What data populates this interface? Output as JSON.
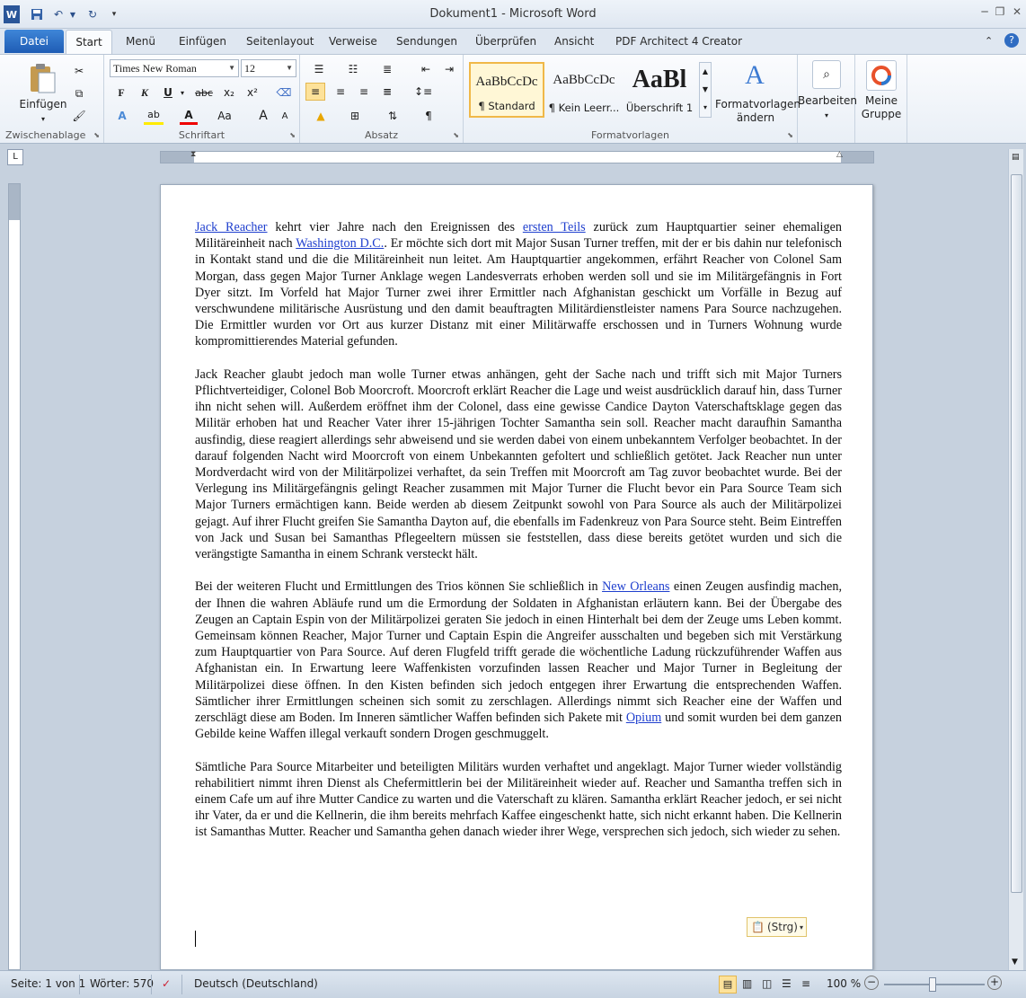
{
  "window": {
    "title": "Dokument1  -  Microsoft Word"
  },
  "tabs": [
    "Start",
    "Menü",
    "Einfügen",
    "Seitenlayout",
    "Verweise",
    "Sendungen",
    "Überprüfen",
    "Ansicht",
    "PDF Architect 4 Creator"
  ],
  "file_tab": "Datei",
  "ribbon": {
    "clipboard": {
      "paste": "Einfügen",
      "label": "Zwischenablage"
    },
    "font": {
      "name": "Times New Roman",
      "size": "12",
      "label": "Schriftart",
      "bold": "F",
      "italic": "K",
      "underline": "U",
      "strike": "abc",
      "sub": "x₂",
      "sup": "x²",
      "case": "Aa",
      "grow": "A",
      "shrink": "A"
    },
    "paragraph": {
      "label": "Absatz"
    },
    "styles": {
      "label": "Formatvorlagen",
      "items": [
        {
          "sample": "AaBbCcDc",
          "name": "¶ Standard"
        },
        {
          "sample": "AaBbCcDc",
          "name": "¶ Kein Leerr..."
        },
        {
          "sample": "AaBl",
          "name": "Überschrift 1"
        }
      ],
      "change": "Formatvorlagen ändern"
    },
    "edit": {
      "label": "Bearbeiten"
    },
    "group": {
      "label": "Meine Gruppe"
    }
  },
  "document": {
    "p1": {
      "l1": "Jack Reacher",
      "t1": " kehrt vier Jahre nach den Ereignissen des ",
      "l2": "ersten Teils",
      "t2": " zurück zum Hauptquartier seiner ehemaligen Militäreinheit nach ",
      "l3": "Washington D.C.",
      "t3": ". Er möchte sich dort mit Major Susan Turner treffen, mit der er bis dahin nur telefonisch in Kontakt stand und die die Militäreinheit nun leitet. Am Hauptquartier angekommen, erfährt Reacher von Colonel Sam Morgan, dass gegen Major Turner Anklage wegen Landesverrats erhoben werden soll und sie im Militärgefängnis in Fort Dyer sitzt. Im Vorfeld hat Major Turner zwei ihrer Ermittler nach Afghanistan geschickt um Vorfälle in Bezug auf verschwundene militärische Ausrüstung und den damit beauftragten Militärdienstleister namens Para Source nachzugehen. Die Ermittler wurden vor Ort aus kurzer Distanz mit einer Militärwaffe erschossen und in Turners Wohnung wurde kompromittierendes Material gefunden."
    },
    "p2": "Jack Reacher glaubt jedoch man wolle Turner etwas anhängen, geht der Sache nach und trifft sich mit Major Turners Pflichtverteidiger, Colonel Bob Moorcroft. Moorcroft erklärt Reacher die Lage und weist ausdrücklich darauf hin, dass Turner ihn nicht sehen will. Außerdem eröffnet ihm der Colonel, dass eine gewisse Candice Dayton Vaterschaftsklage gegen das Militär erhoben hat und Reacher Vater ihrer 15-jährigen Tochter Samantha sein soll. Reacher macht daraufhin Samantha ausfindig, diese reagiert allerdings sehr abweisend und sie werden dabei von einem unbekanntem Verfolger beobachtet. In der darauf folgenden Nacht wird Moorcroft von einem Unbekannten gefoltert und schließlich getötet. Jack Reacher nun unter Mordverdacht wird von der Militärpolizei verhaftet, da sein Treffen mit Moorcroft am Tag zuvor beobachtet wurde. Bei der Verlegung ins Militärgefängnis gelingt Reacher zusammen mit Major Turner die Flucht bevor ein Para Source Team sich Major Turners ermächtigen kann. Beide werden ab diesem Zeitpunkt sowohl von Para Source als auch der Militärpolizei gejagt. Auf ihrer Flucht greifen Sie Samantha Dayton auf, die ebenfalls im Fadenkreuz von Para Source steht. Beim Eintreffen von Jack und Susan bei Samanthas Pflegeeltern müssen sie feststellen, dass diese bereits getötet wurden und sich die verängstigte Samantha in einem Schrank versteckt hält.",
    "p3": {
      "t1": "Bei der weiteren Flucht und Ermittlungen des Trios können Sie schließlich in ",
      "l1": "New Orleans",
      "t2": " einen Zeugen ausfindig machen, der Ihnen die wahren Abläufe rund um die Ermordung der Soldaten in Afghanistan erläutern kann. Bei der Übergabe des Zeugen an Captain Espin von der Militärpolizei geraten Sie jedoch in einen Hinterhalt bei dem der Zeuge ums Leben kommt. Gemeinsam können Reacher, Major Turner und Captain Espin die Angreifer ausschalten und begeben sich mit Verstärkung zum Hauptquartier von Para Source. Auf deren Flugfeld trifft gerade die wöchentliche Ladung rückzuführender Waffen aus Afghanistan ein. In Erwartung leere Waffenkisten vorzufinden lassen Reacher und Major Turner in Begleitung der Militärpolizei diese öffnen. In den Kisten befinden sich jedoch entgegen ihrer Erwartung die entsprechenden Waffen. Sämtlicher ihrer Ermittlungen scheinen sich somit zu zerschlagen. Allerdings nimmt sich Reacher eine der Waffen und zerschlägt diese am Boden. Im Inneren sämtlicher Waffen befinden sich Pakete mit ",
      "l2": "Opium",
      "t3": " und somit wurden bei dem ganzen Gebilde keine Waffen illegal verkauft sondern Drogen geschmuggelt."
    },
    "p4": "Sämtliche Para Source Mitarbeiter und beteiligten Militärs wurden verhaftet und angeklagt. Major Turner wieder vollständig rehabilitiert nimmt ihren Dienst als Chefermittlerin bei der Militäreinheit wieder auf. Reacher und Samantha treffen sich in einem Cafe um auf ihre Mutter Candice zu warten und die Vaterschaft zu klären. Samantha erklärt Reacher jedoch, er sei nicht ihr Vater, da er und die Kellnerin, die ihm bereits mehrfach Kaffee eingeschenkt hatte, sich nicht erkannt haben. Die Kellnerin ist Samanthas Mutter. Reacher und Samantha gehen danach wieder ihrer Wege, versprechen sich jedoch, sich wieder zu sehen.",
    "paste_tag": "(Strg)"
  },
  "status": {
    "page": "Seite: 1 von 1",
    "words": "Wörter: 570",
    "language": "Deutsch (Deutschland)",
    "zoom": "100 %"
  }
}
